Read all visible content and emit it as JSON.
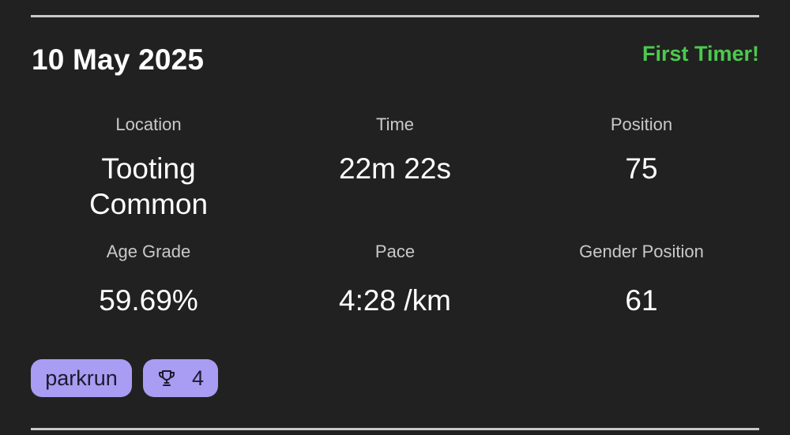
{
  "header": {
    "date": "10 May 2025",
    "badge": "First Timer!",
    "badge_color": "#4cc94e"
  },
  "stats": {
    "location": {
      "label": "Location",
      "value": "Tooting Common"
    },
    "time": {
      "label": "Time",
      "value": "22m 22s"
    },
    "position": {
      "label": "Position",
      "value": "75"
    },
    "age_grade": {
      "label": "Age Grade",
      "value": "59.69%"
    },
    "pace": {
      "label": "Pace",
      "value": "4:28 /km"
    },
    "gender_position": {
      "label": "Gender Position",
      "value": "61"
    }
  },
  "chips": {
    "event": "parkrun",
    "trophy_icon": "trophy-icon",
    "trophy_count": "4",
    "chip_color": "#a99cf3"
  }
}
